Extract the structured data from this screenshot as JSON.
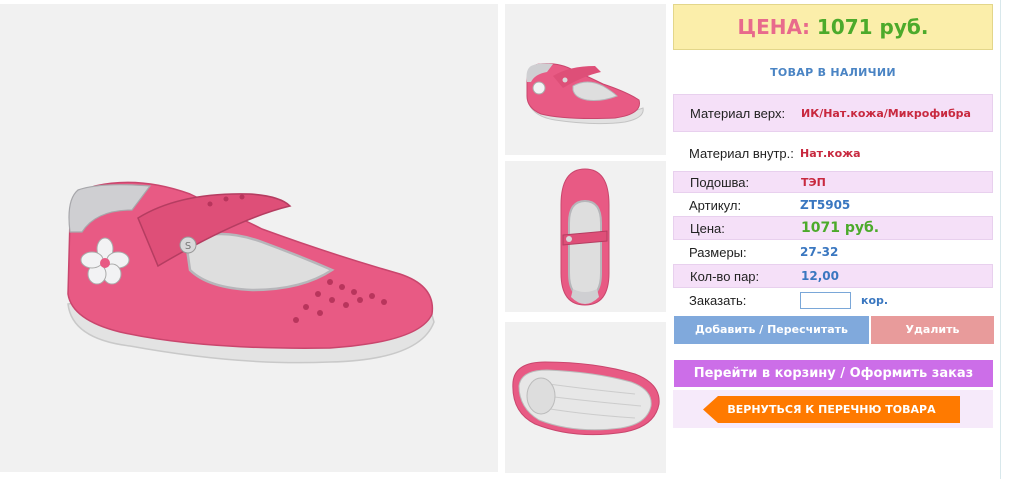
{
  "price_box": {
    "label": "ЦЕНА:",
    "value": "1071 руб."
  },
  "stock_status": "ТОВАР В НАЛИЧИИ",
  "specs": [
    {
      "label": "Материал верх:",
      "value": "ИК/Нат.кожа/Микрофибра"
    },
    {
      "label": "Материал внутр.:",
      "value": "Нат.кожа"
    },
    {
      "label": "Подошва:",
      "value": "ТЭП"
    },
    {
      "label": "Артикул:",
      "value": "ZT5905"
    },
    {
      "label": "Цена:",
      "value": "1071 руб."
    },
    {
      "label": "Размеры:",
      "value": "27-32"
    },
    {
      "label": "Кол-во пар:",
      "value": "12,00"
    }
  ],
  "order": {
    "label": "Заказать:",
    "value": "",
    "unit": "кор."
  },
  "buttons": {
    "add": "Добавить / Пересчитать",
    "delete": "Удалить",
    "cart": "Перейти в корзину / Оформить заказ",
    "back": "ВЕРНУТЬСЯ К ПЕРЕЧНЮ ТОВАРА"
  },
  "colors": {
    "price_label": "#e86a8c",
    "price_value": "#4caa2b",
    "spec_highlight": "#f5e0f8",
    "add_button": "#80a9dc",
    "delete_button": "#e89b9b",
    "cart_button": "#cc6ee8",
    "back_button": "#ff7a00",
    "shoe_pink": "#e85a84"
  }
}
